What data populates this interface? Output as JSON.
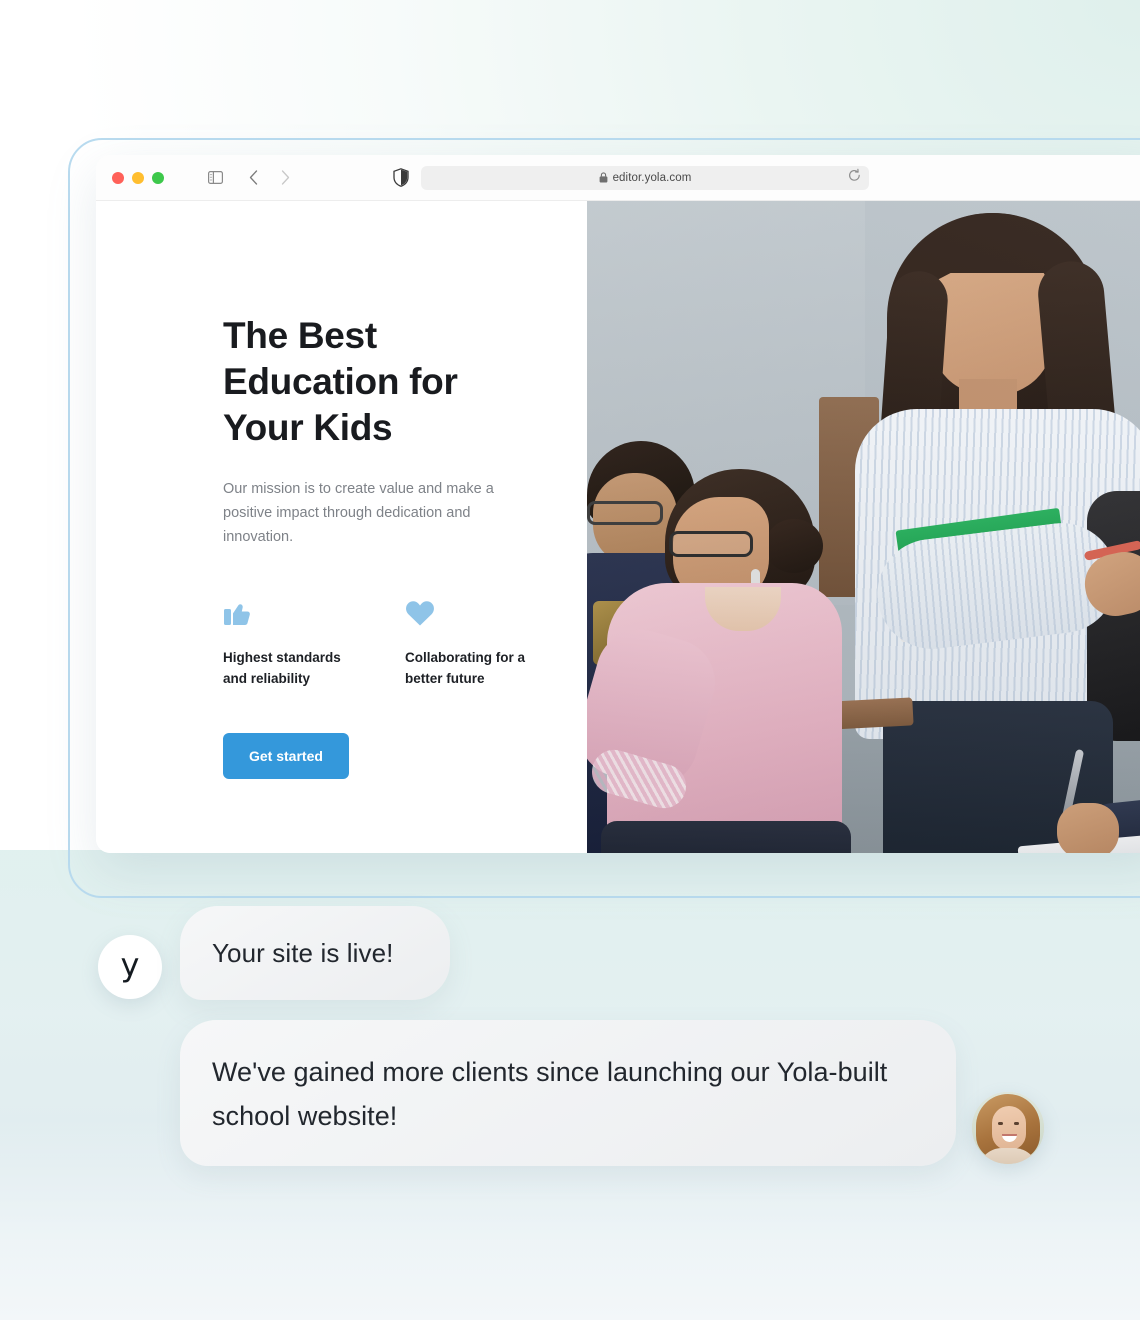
{
  "browser": {
    "traffic_lights": [
      "close",
      "minimize",
      "zoom"
    ],
    "sidebar_icon": "sidebar-toggle-icon",
    "back_icon": "chevron-left-icon",
    "forward_icon": "chevron-right-icon",
    "shield_icon": "shield-icon",
    "lock_icon": "lock-icon",
    "url": "editor.yola.com",
    "reload_icon": "reload-icon"
  },
  "hero": {
    "headline": "The Best Education for Your Kids",
    "headline_lines": [
      "The Best",
      "Education for",
      "Your Kids"
    ],
    "paragraph": "Our mission is to create value and make a positive impact through dedication and innovation.",
    "features": [
      {
        "icon": "thumbs-up-icon",
        "label": "Highest standards and reliability"
      },
      {
        "icon": "heart-icon",
        "label": "Collaborating for a better future"
      }
    ],
    "cta_label": "Get started",
    "photo_alt": "students-in-classroom-photo"
  },
  "chat": {
    "brand_avatar_letter": "y",
    "messages": [
      {
        "id": "bubble-site-live",
        "text": "Your site is live!"
      },
      {
        "id": "bubble-testimonial",
        "text": "We've gained more clients since launching our Yola-built school website!"
      }
    ],
    "person_avatar_alt": "smiling-woman-avatar"
  },
  "colors": {
    "accent_blue": "#3498db",
    "feature_icon_blue": "#8fc4e8",
    "headline": "#191b1f",
    "body_text": "#7e8288",
    "bubble_bg": "#f1f3f4",
    "frame_border": "#b9dbef",
    "traffic_red": "#ff6159",
    "traffic_yellow": "#ffbe2f",
    "traffic_green": "#3dc84b"
  }
}
